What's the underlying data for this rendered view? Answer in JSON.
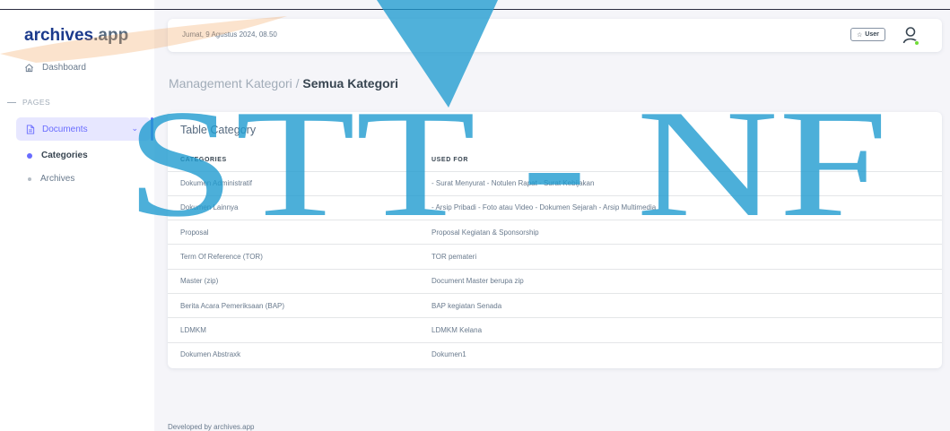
{
  "sidebar": {
    "brand_main": "archives",
    "brand_suffix": ".app",
    "dashboard_label": "Dashboard",
    "section_label": "PAGES",
    "documents_label": "Documents",
    "items": [
      {
        "label": "Categories",
        "active": true
      },
      {
        "label": "Archives",
        "active": false
      }
    ]
  },
  "navbar": {
    "date": "Jumat, 9 Agustus 2024, 08.50",
    "user_badge": "User"
  },
  "breadcrumb": {
    "parent": "Management Kategori /",
    "current": "Semua Kategori"
  },
  "card": {
    "title": "Table Category",
    "columns": [
      "CATEGORIES",
      "USED FOR"
    ],
    "rows": [
      [
        "Dokumen Administratif",
        "- Surat Menyurat - Notulen Rapat - Surat Kebijakan"
      ],
      [
        "Dokumen Lainnya",
        "- Arsip Pribadi - Foto atau Video - Dokumen Sejarah - Arsip Multimedia"
      ],
      [
        "Proposal",
        "Proposal Kegiatan & Sponsorship"
      ],
      [
        "Term Of Reference (TOR)",
        "TOR pemateri"
      ],
      [
        "Master (zip)",
        "Document Master berupa zip"
      ],
      [
        "Berita Acara Pemeriksaan (BAP)",
        "BAP kegiatan Senada"
      ],
      [
        "LDMKM",
        "LDMKM Kelana"
      ],
      [
        "Dokumen Abstraxk",
        "Dokumen1"
      ]
    ]
  },
  "footer": "Developed by archives.app",
  "watermark_text": "STT - NF",
  "colors": {
    "primary": "#696cff",
    "brand_dark": "#1b3a8c",
    "watermark": "#1f9bcf",
    "watermark_accent": "#f29a4a",
    "online": "#71dd37"
  }
}
